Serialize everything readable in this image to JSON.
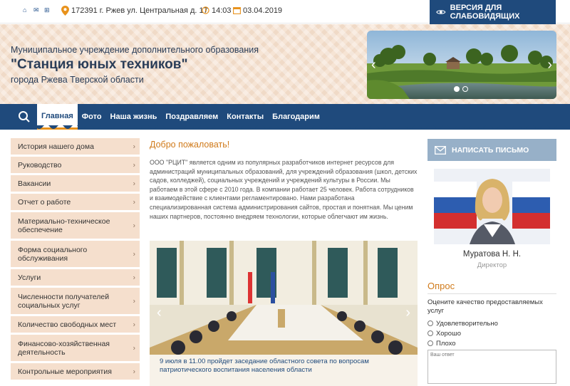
{
  "topbar": {
    "address": "172391 г. Ржев ул. Центральная д. 17",
    "time": "14:03",
    "date": "03.04.2019",
    "vision_label": "ВЕРСИЯ ДЛЯ СЛАБОВИДЯЩИХ"
  },
  "header": {
    "line1": "Муниципальное учреждение дополнительного образования",
    "line2": "\"Станция юных техников\"",
    "line3": "города Ржева Тверской области"
  },
  "nav": {
    "items": [
      "Главная",
      "Фото",
      "Наша жизнь",
      "Поздравляем",
      "Контакты",
      "Благодарим"
    ]
  },
  "sidebar": {
    "items": [
      "История нашего дома",
      "Руководство",
      "Вакансии",
      "Отчет о работе",
      "Материально-техническое обеспечение",
      "Форма социального обслуживания",
      "Услуги",
      "Численности получателей социальных услуг",
      "Количество свободных мест",
      "Финансово-хозяйственная деятельность",
      "Контрольные мероприятия"
    ]
  },
  "main": {
    "title": "Добро пожаловать!",
    "text": "ООО \"РЦИТ\" является одним из популярных разработчиков интернет ресурсов для администраций муниципальных образований, для учреждений образования (школ, детских садов, колледжей), социальных учреждений и учреждений культуры в России. Мы работаем в этой сфере с 2010 года. В компании работает 25 человек. Работа сотрудников и взаимодействие с клиентами регламентировано. Нами разработана специализированная система администрирования сайтов, простая и понятная. Мы ценим наших партнеров, постоянно внедряем технологии, которые облегчают им жизнь.",
    "news_caption": "9 июля в 11.00 пройдет заседание областного совета по вопросам патриотического воспитания населения области"
  },
  "right": {
    "write_label": "НАПИСАТЬ ПИСЬМО",
    "person_name": "Муратова Н. Н.",
    "person_role": "Директор",
    "poll_title": "Опрос",
    "poll_question": "Оцените качество предоставляемых услуг",
    "poll_options": [
      "Удовлетворительно",
      "Хорошо",
      "Плохо"
    ],
    "answer_placeholder": "Ваш ответ"
  },
  "colors": {
    "brand_blue": "#1f4a7c",
    "accent_orange": "#d07a1a",
    "sidebar_bg": "#f5dfcd"
  }
}
